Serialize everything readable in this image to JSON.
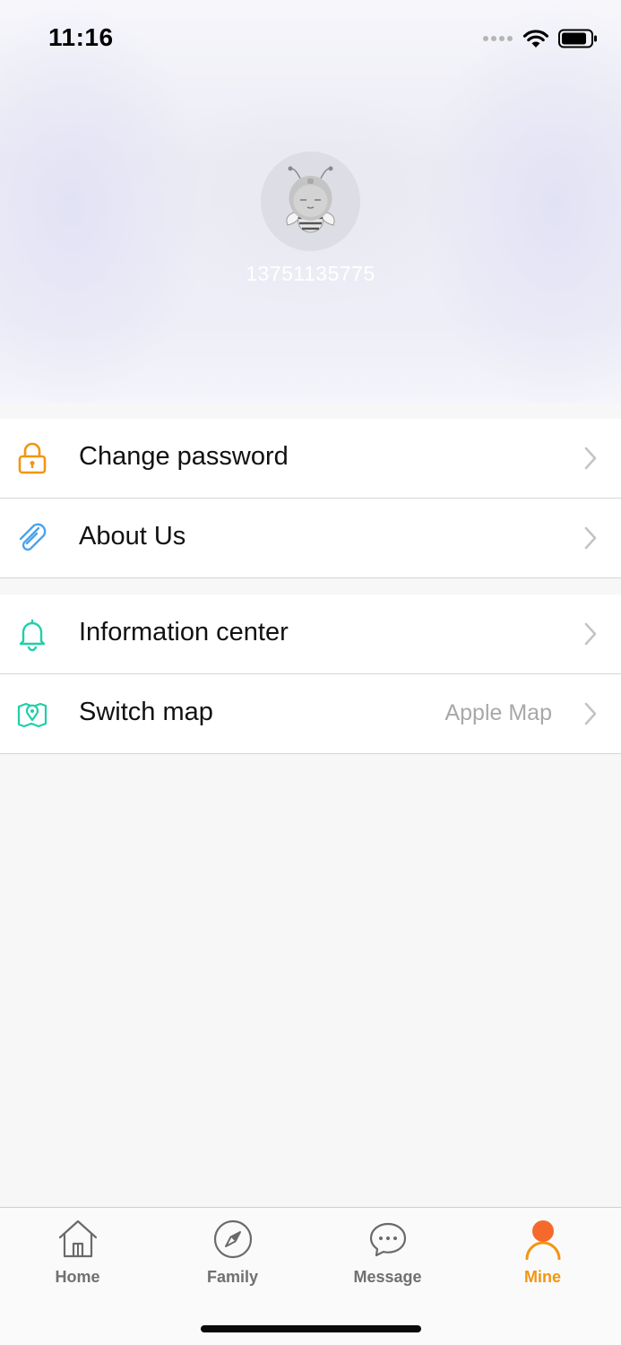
{
  "status_bar": {
    "time": "11:16",
    "icons": [
      "signal-dots-icon",
      "wifi-icon",
      "battery-icon"
    ]
  },
  "profile": {
    "avatar": "bee-avatar",
    "phone": "13751135775"
  },
  "menu_groups": [
    {
      "items": [
        {
          "label": "Change password",
          "icon": "lock-icon",
          "icon_color": "#f39512"
        },
        {
          "label": "About Us",
          "icon": "paperclip-icon",
          "icon_color": "#4aa3f0"
        }
      ]
    },
    {
      "items": [
        {
          "label": "Information center",
          "icon": "bell-icon",
          "icon_color": "#1fcfa8"
        },
        {
          "label": "Switch map",
          "value": "Apple Map",
          "icon": "map-pin-icon",
          "icon_color": "#1fcfa8"
        }
      ]
    }
  ],
  "tabbar": {
    "tabs": [
      {
        "label": "Home",
        "icon": "house-icon",
        "active": false
      },
      {
        "label": "Family",
        "icon": "compass-icon",
        "active": false
      },
      {
        "label": "Message",
        "icon": "chat-bubble-icon",
        "active": false
      },
      {
        "label": "Mine",
        "icon": "person-icon",
        "active": true
      }
    ],
    "active_color": "#f39512",
    "inactive_color": "#707070"
  }
}
